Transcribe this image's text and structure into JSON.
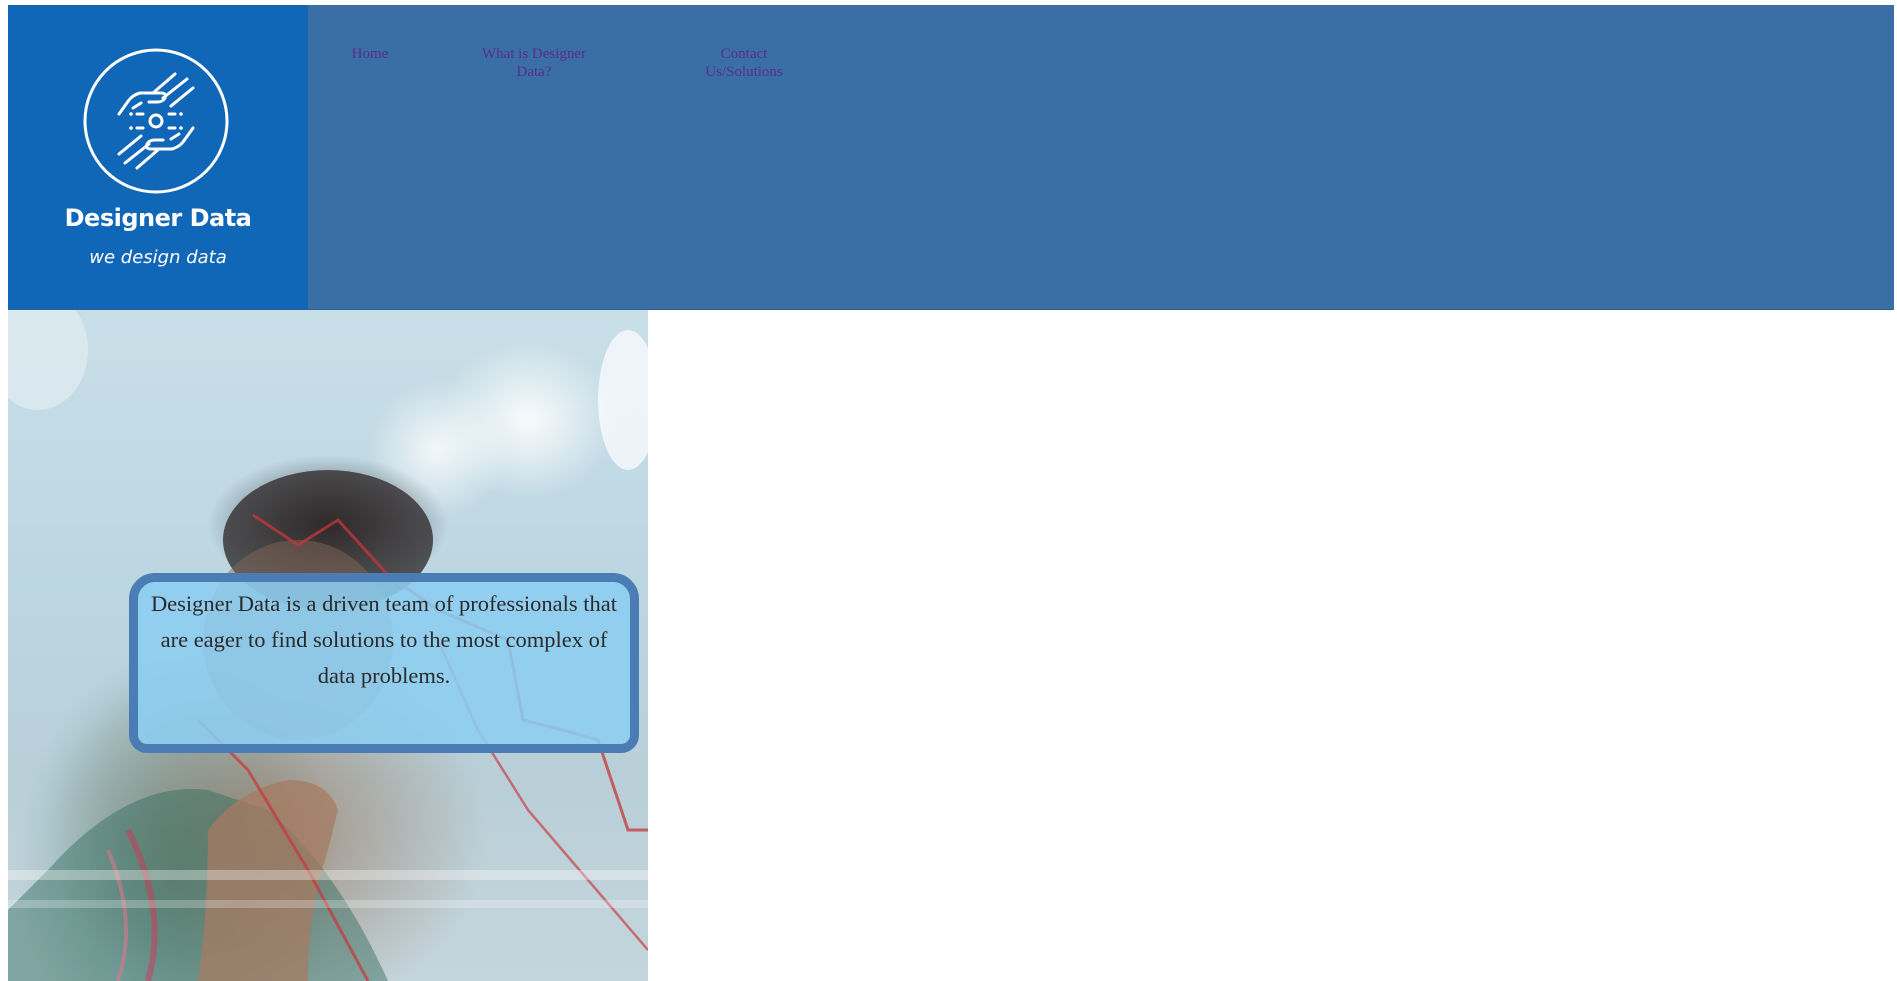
{
  "brand": {
    "name": "Designer Data",
    "tagline": "we design data",
    "logo_icon": "hands-data-icon",
    "colors": {
      "header": "#3a6fa6",
      "logo_background": "#1066b7",
      "nav_link": "#5b2a8f",
      "hero_box_border": "#4a7db3",
      "hero_box_fill": "#8ccdf0"
    }
  },
  "nav": {
    "items": [
      {
        "label": "Home"
      },
      {
        "label": "What is Designer Data?"
      },
      {
        "label": "Contact Us/Solutions"
      }
    ]
  },
  "hero": {
    "image": "person-drawing-chart-on-glass",
    "text": "Designer Data is a driven team of professionals that are eager to find solutions to the most complex of data problems."
  }
}
